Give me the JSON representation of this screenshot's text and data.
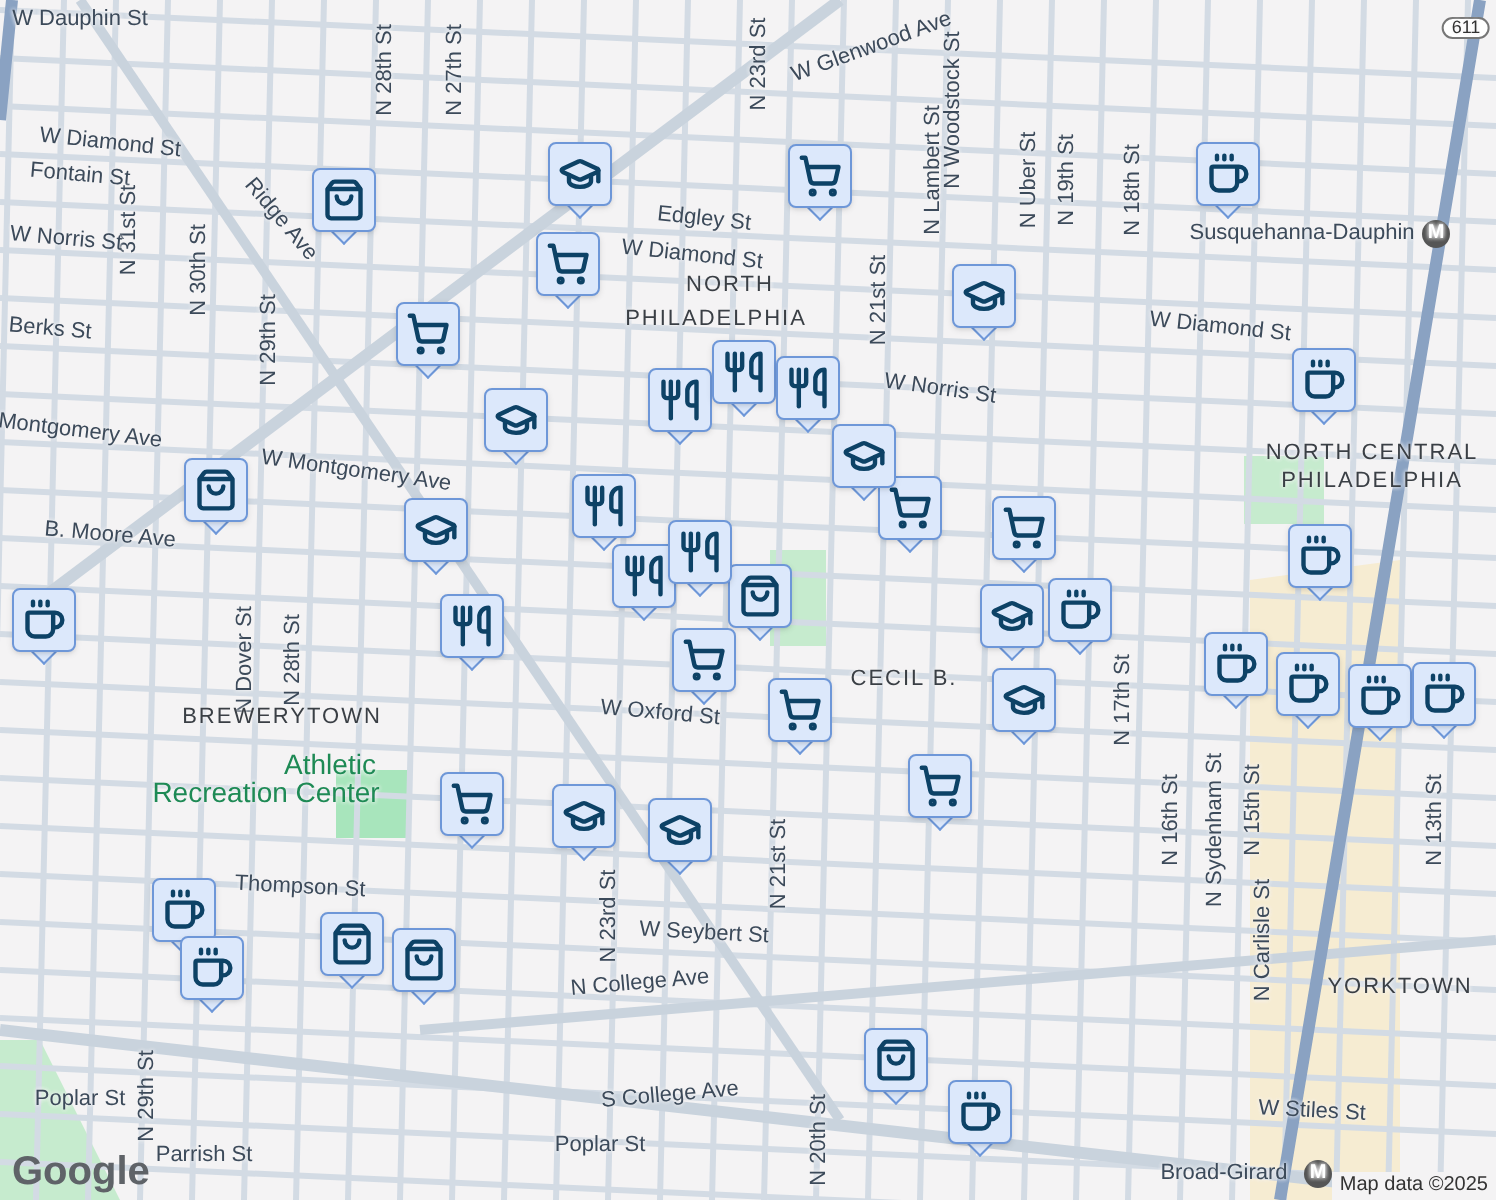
{
  "map": {
    "labels": [
      {
        "text": "W Dauphin St",
        "kind": "street"
      },
      {
        "text": "W Glenwood Ave",
        "kind": "street"
      },
      {
        "text": "W Diamond St",
        "kind": "street"
      },
      {
        "text": "Fontain St",
        "kind": "street"
      },
      {
        "text": "N 28th St",
        "kind": "street"
      },
      {
        "text": "N 27th St",
        "kind": "street"
      },
      {
        "text": "Ridge Ave",
        "kind": "street"
      },
      {
        "text": "Edgley St",
        "kind": "street"
      },
      {
        "text": "W Diamond St",
        "kind": "street"
      },
      {
        "text": "NORTH",
        "kind": "area"
      },
      {
        "text": "PHILADELPHIA",
        "kind": "area"
      },
      {
        "text": "W Diamond St",
        "kind": "street"
      },
      {
        "text": "W Norris St",
        "kind": "street"
      },
      {
        "text": "Susquehanna-Dauphin",
        "kind": "street"
      },
      {
        "text": "N 23rd St",
        "kind": "street"
      },
      {
        "text": "N 21st St",
        "kind": "street"
      },
      {
        "text": "N Uber St",
        "kind": "street"
      },
      {
        "text": "N 19th St",
        "kind": "street"
      },
      {
        "text": "N 18th St",
        "kind": "street"
      },
      {
        "text": "N Lambert St",
        "kind": "street"
      },
      {
        "text": "NORTH CENTRAL",
        "kind": "area"
      },
      {
        "text": "PHILADELPHIA",
        "kind": "area"
      },
      {
        "text": "W Montgomery Ave",
        "kind": "street"
      },
      {
        "text": "B. Moore Ave",
        "kind": "street"
      },
      {
        "text": "N 31st St",
        "kind": "street"
      },
      {
        "text": "N 30th St",
        "kind": "street"
      },
      {
        "text": "N 29th St",
        "kind": "street"
      },
      {
        "text": "N Dover St",
        "kind": "street"
      },
      {
        "text": "N 28th St",
        "kind": "street"
      },
      {
        "text": "BREWERYTOWN",
        "kind": "area"
      },
      {
        "text": "Athletic",
        "kind": "park"
      },
      {
        "text": "Recreation Center",
        "kind": "park"
      },
      {
        "text": "W Oxford St",
        "kind": "street"
      },
      {
        "text": "CECIL B.",
        "kind": "area"
      },
      {
        "text": "N 17th St",
        "kind": "street"
      },
      {
        "text": "N 16th St",
        "kind": "street"
      },
      {
        "text": "N Sydenham St",
        "kind": "street"
      },
      {
        "text": "N 15th St",
        "kind": "street"
      },
      {
        "text": "N 13th St",
        "kind": "street"
      },
      {
        "text": "N Carlisle St",
        "kind": "street"
      },
      {
        "text": "YORKTOWN",
        "kind": "area"
      },
      {
        "text": "Thompson St",
        "kind": "street"
      },
      {
        "text": "W Seybert St",
        "kind": "street"
      },
      {
        "text": "N College Ave",
        "kind": "street"
      },
      {
        "text": "S College Ave",
        "kind": "street"
      },
      {
        "text": "Poplar St",
        "kind": "street"
      },
      {
        "text": "Poplar St",
        "kind": "street"
      },
      {
        "text": "Parrish St",
        "kind": "street"
      },
      {
        "text": "W Stiles St",
        "kind": "street"
      },
      {
        "text": "Broad-Girard",
        "kind": "street"
      },
      {
        "text": "N 23rd St",
        "kind": "street"
      },
      {
        "text": "N 21st St",
        "kind": "street"
      },
      {
        "text": "N 29th St",
        "kind": "street"
      },
      {
        "text": "N 20th St",
        "kind": "street"
      },
      {
        "text": "N Woodstock St",
        "kind": "street"
      },
      {
        "text": "Montgomery Ave",
        "kind": "street"
      },
      {
        "text": "W Norris St",
        "kind": "street"
      },
      {
        "text": "Berks St",
        "kind": "street"
      },
      {
        "text": "611",
        "kind": "shield"
      },
      {
        "text": "M",
        "kind": "transit"
      },
      {
        "text": "M",
        "kind": "transit"
      }
    ],
    "markers": [
      {
        "kind": "cafe"
      },
      {
        "kind": "cafe"
      },
      {
        "kind": "cafe"
      },
      {
        "kind": "cafe"
      },
      {
        "kind": "cafe"
      },
      {
        "kind": "cafe"
      },
      {
        "kind": "cafe"
      },
      {
        "kind": "cafe"
      },
      {
        "kind": "cafe"
      },
      {
        "kind": "cafe"
      },
      {
        "kind": "cafe"
      },
      {
        "kind": "cafe"
      },
      {
        "kind": "bag"
      },
      {
        "kind": "bag"
      },
      {
        "kind": "bag"
      },
      {
        "kind": "bag"
      },
      {
        "kind": "bag"
      },
      {
        "kind": "bag"
      },
      {
        "kind": "cart"
      },
      {
        "kind": "cart"
      },
      {
        "kind": "cart"
      },
      {
        "kind": "cart"
      },
      {
        "kind": "cart"
      },
      {
        "kind": "cart"
      },
      {
        "kind": "cart"
      },
      {
        "kind": "cart"
      },
      {
        "kind": "cart"
      },
      {
        "kind": "school"
      },
      {
        "kind": "school"
      },
      {
        "kind": "school"
      },
      {
        "kind": "school"
      },
      {
        "kind": "school"
      },
      {
        "kind": "school"
      },
      {
        "kind": "school"
      },
      {
        "kind": "school"
      },
      {
        "kind": "school"
      },
      {
        "kind": "food"
      },
      {
        "kind": "food"
      },
      {
        "kind": "food"
      },
      {
        "kind": "food"
      },
      {
        "kind": "food"
      },
      {
        "kind": "food"
      },
      {
        "kind": "food"
      }
    ]
  },
  "logo": "Google",
  "attribution": "Map data ©2025"
}
